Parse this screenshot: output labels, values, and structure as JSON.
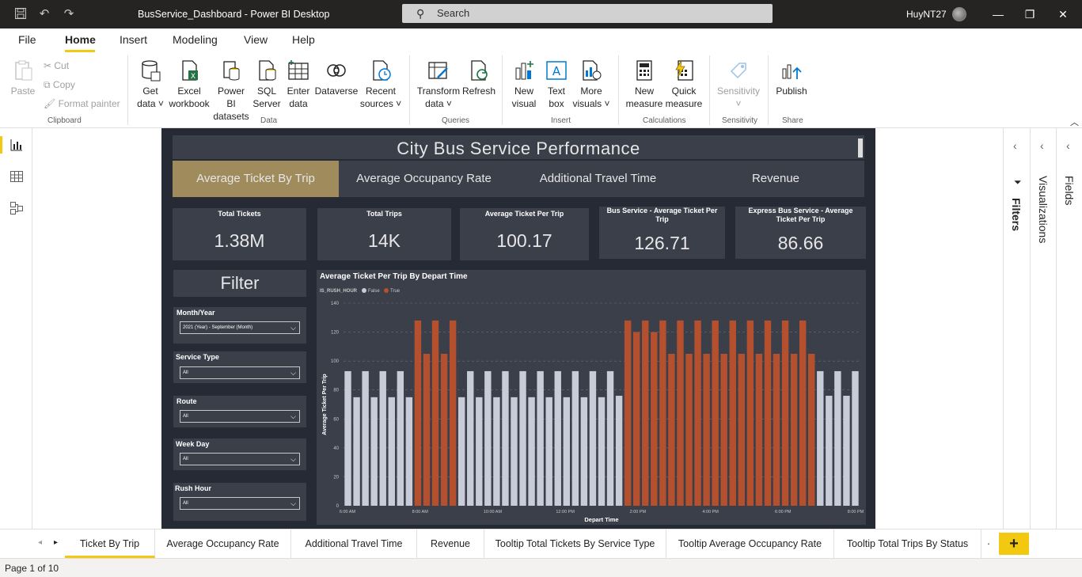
{
  "window": {
    "title": "BusService_Dashboard - Power BI Desktop",
    "search_placeholder": "Search",
    "user": "HuyNT27"
  },
  "menu": [
    "File",
    "Home",
    "Insert",
    "Modeling",
    "View",
    "Help"
  ],
  "ribbon": {
    "clipboard": {
      "paste": "Paste",
      "cut": "Cut",
      "copy": "Copy",
      "format_painter": "Format painter",
      "group": "Clipboard"
    },
    "data": {
      "get_data": [
        "Get",
        "data"
      ],
      "excel": [
        "Excel",
        "workbook"
      ],
      "pbi_datasets": [
        "Power BI",
        "datasets"
      ],
      "sql": [
        "SQL",
        "Server"
      ],
      "enter_data": [
        "Enter",
        "data"
      ],
      "dataverse": "Dataverse",
      "recent": [
        "Recent",
        "sources"
      ],
      "group": "Data"
    },
    "queries": {
      "transform": [
        "Transform",
        "data"
      ],
      "refresh": "Refresh",
      "group": "Queries"
    },
    "insert": {
      "new_visual": [
        "New",
        "visual"
      ],
      "text_box": [
        "Text",
        "box"
      ],
      "more_visuals": [
        "More",
        "visuals"
      ],
      "group": "Insert"
    },
    "calculations": {
      "new_measure": [
        "New",
        "measure"
      ],
      "quick_measure": [
        "Quick",
        "measure"
      ],
      "group": "Calculations"
    },
    "sensitivity": {
      "label": "Sensitivity",
      "group": "Sensitivity"
    },
    "share": {
      "publish": "Publish",
      "group": "Share"
    }
  },
  "panes": {
    "filters": "Filters",
    "visualizations": "Visualizations",
    "fields": "Fields"
  },
  "report": {
    "title": "City Bus Service Performance",
    "nav": [
      "Average Ticket By Trip",
      "Average Occupancy Rate",
      "Additional Travel Time",
      "Revenue"
    ],
    "cards": [
      {
        "label": "Total Tickets",
        "value": "1.38M"
      },
      {
        "label": "Total Trips",
        "value": "14K"
      },
      {
        "label": "Average Ticket Per Trip",
        "value": "100.17"
      },
      {
        "label": "Bus Service - Average Ticket Per Trip",
        "value": "126.71"
      },
      {
        "label": "Express Bus Service - Average Ticket Per Trip",
        "value": "86.66"
      }
    ],
    "filter_title": "Filter",
    "filters": [
      {
        "label": "Month/Year",
        "value": "2021 (Year) - September (Month)"
      },
      {
        "label": "Service Type",
        "value": "All"
      },
      {
        "label": "Route",
        "value": "All"
      },
      {
        "label": "Week Day",
        "value": "All"
      },
      {
        "label": "Rush Hour",
        "value": "All"
      }
    ]
  },
  "chart_data": {
    "type": "bar",
    "title": "Average Ticket Per Trip By Depart Time",
    "xlabel": "Depart Time",
    "ylabel": "Average Ticket Per Trip",
    "legend_title": "IS_RUSH_HOUR",
    "legend": [
      {
        "name": "False",
        "color": "#c8ccd8"
      },
      {
        "name": "True",
        "color": "#b5502f"
      }
    ],
    "ylim": [
      0,
      140
    ],
    "yticks": [
      0,
      20,
      40,
      60,
      80,
      100,
      120,
      140
    ],
    "xtick_labels": [
      "6:00 AM",
      "8:00 AM",
      "10:00 AM",
      "12:00 PM",
      "2:00 PM",
      "4:00 PM",
      "6:00 PM",
      "8:00 PM"
    ],
    "grid": true,
    "values": [
      93,
      75,
      93,
      75,
      93,
      75,
      93,
      75,
      128,
      105,
      128,
      105,
      128,
      75,
      93,
      75,
      93,
      75,
      93,
      75,
      93,
      75,
      93,
      75,
      93,
      75,
      93,
      75,
      93,
      75,
      93,
      76,
      128,
      120,
      128,
      120,
      128,
      105,
      128,
      105,
      128,
      105,
      128,
      105,
      128,
      105,
      128,
      105,
      128,
      105,
      128,
      105,
      128,
      105,
      93,
      76,
      93,
      76,
      93
    ],
    "rush": [
      0,
      0,
      0,
      0,
      0,
      0,
      0,
      0,
      1,
      1,
      1,
      1,
      1,
      0,
      0,
      0,
      0,
      0,
      0,
      0,
      0,
      0,
      0,
      0,
      0,
      0,
      0,
      0,
      0,
      0,
      0,
      0,
      1,
      1,
      1,
      1,
      1,
      1,
      1,
      1,
      1,
      1,
      1,
      1,
      1,
      1,
      1,
      1,
      1,
      1,
      1,
      1,
      1,
      1,
      0,
      0,
      0,
      0,
      0
    ]
  },
  "tabs": [
    "Ticket By Trip",
    "Average Occupancy Rate",
    "Additional Travel Time",
    "Revenue",
    "Tooltip Total Tickets By Service Type",
    "Tooltip Average Occupancy Rate",
    "Tooltip Total Trips By Status"
  ],
  "status": "Page 1 of 10",
  "colors": {
    "accent": "#f2c811",
    "report_bg": "#252a35",
    "tile_bg": "#3b3f4a",
    "active_nav": "#a08b5c"
  }
}
